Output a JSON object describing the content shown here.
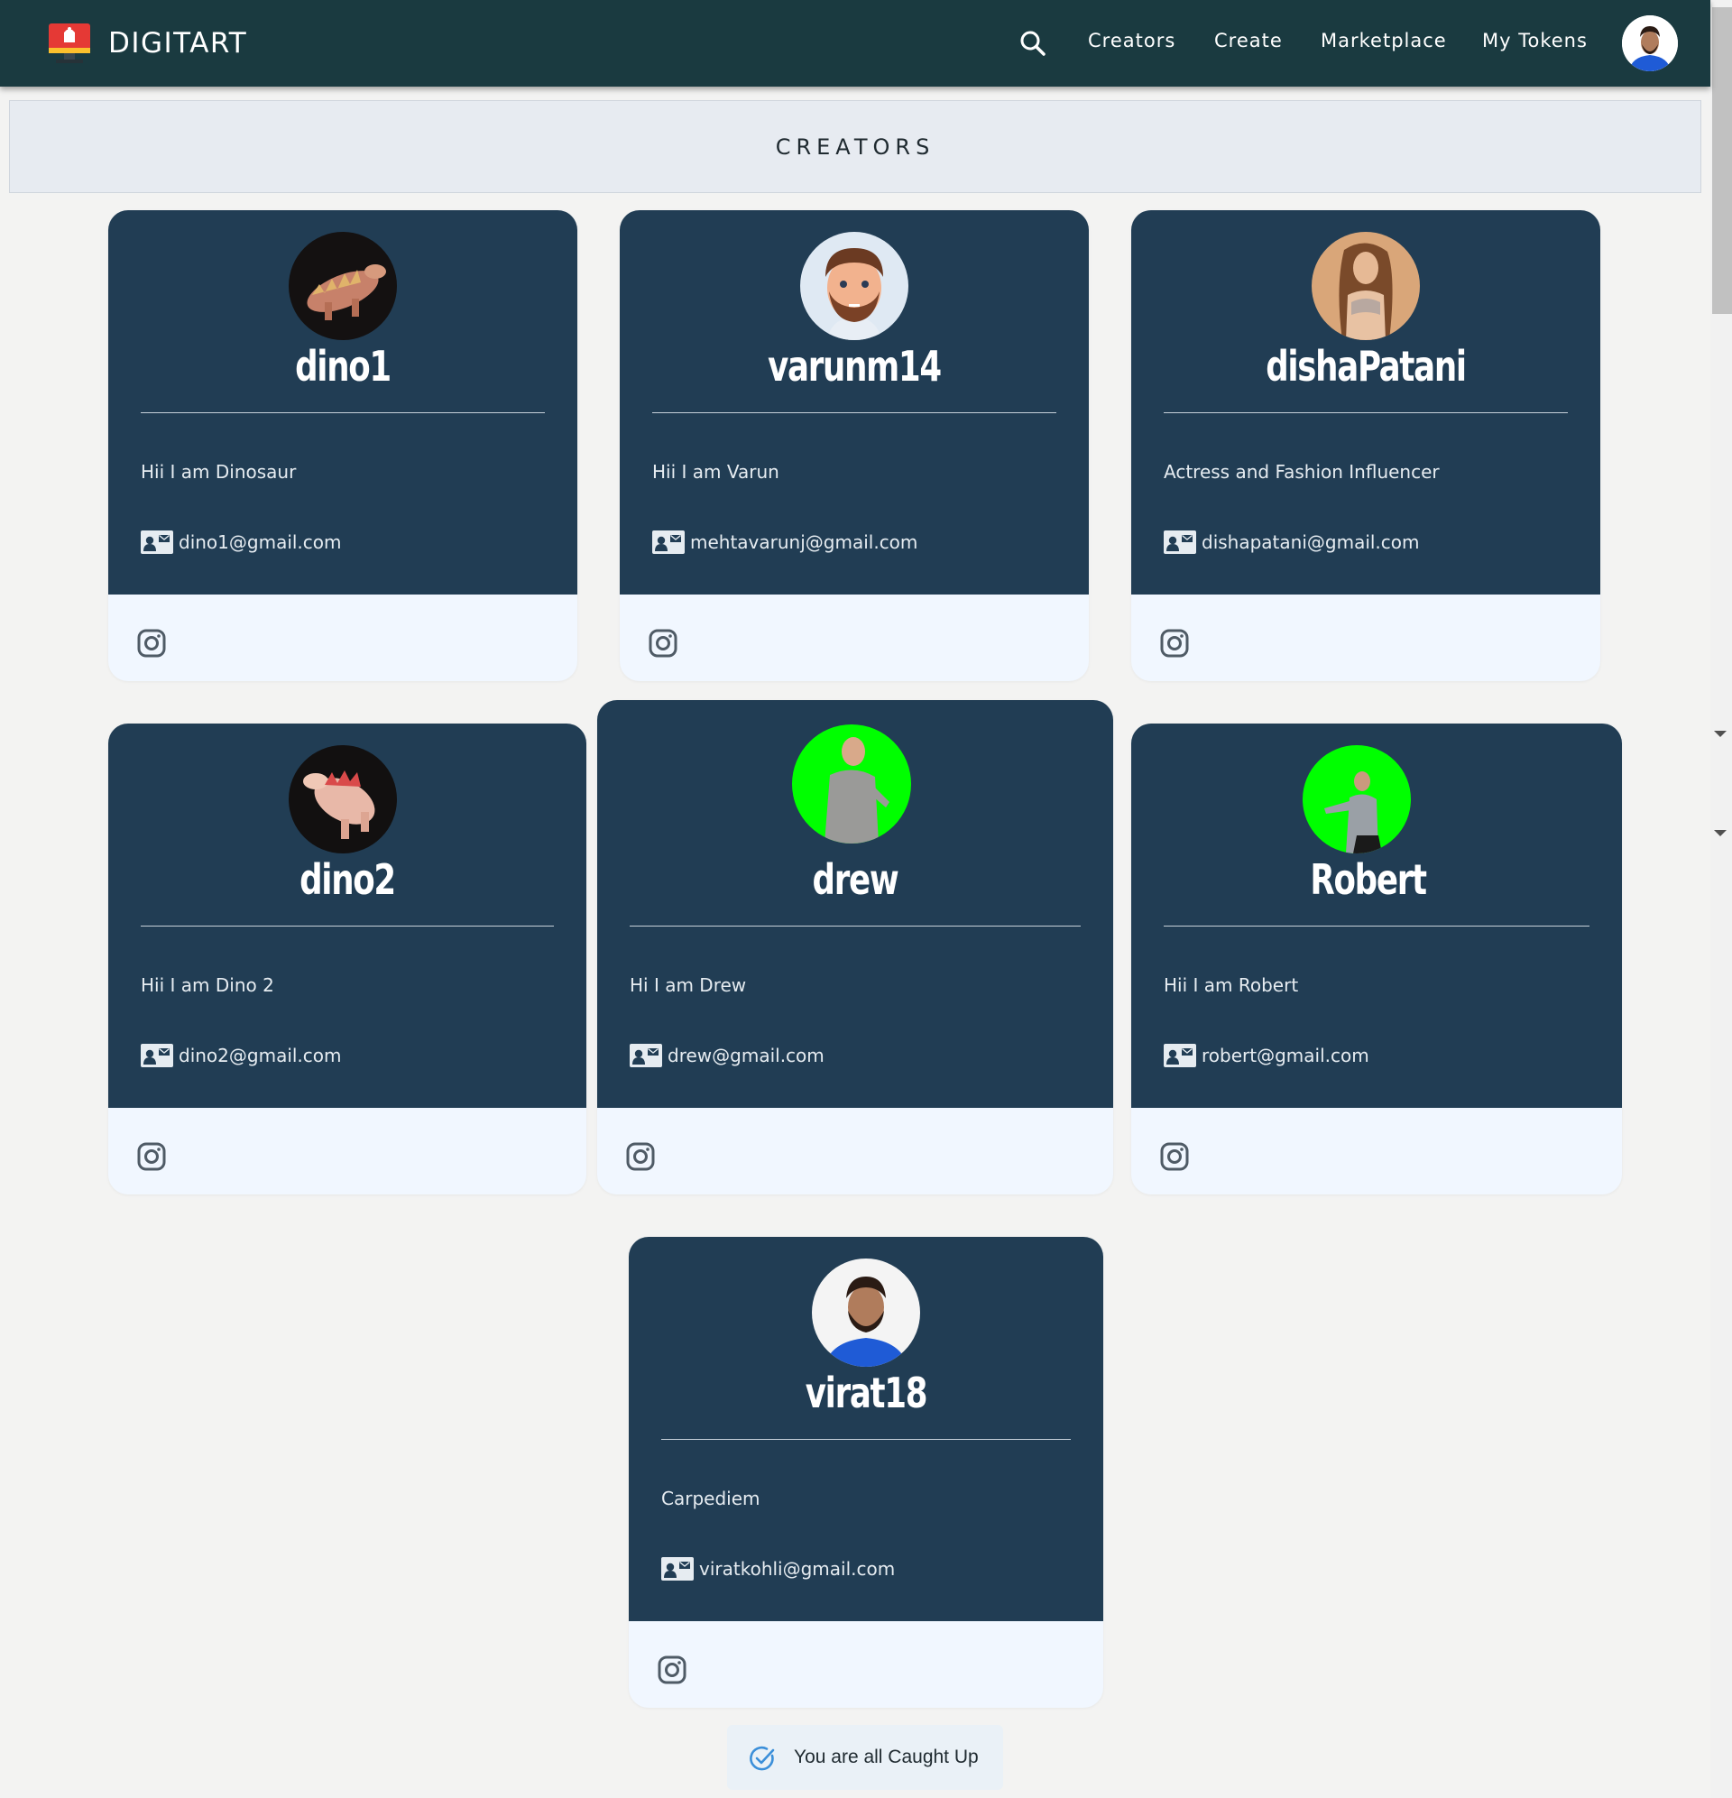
{
  "navbar": {
    "brand": "DIGITART",
    "links": [
      "Creators",
      "Create",
      "Marketplace",
      "My Tokens"
    ]
  },
  "banner": {
    "title": "CREATORS"
  },
  "creators": [
    {
      "username": "dino1",
      "bio": "Hii I am Dinosaur",
      "email": "dino1@gmail.com"
    },
    {
      "username": "varunm14",
      "bio": "Hii I am Varun",
      "email": "mehtavarunj@gmail.com"
    },
    {
      "username": "dishaPatani",
      "bio": "Actress and Fashion Influencer",
      "email": "dishapatani@gmail.com"
    },
    {
      "username": "dino2",
      "bio": "Hii I am Dino 2",
      "email": "dino2@gmail.com"
    },
    {
      "username": "drew",
      "bio": "Hi I am Drew",
      "email": "drew@gmail.com"
    },
    {
      "username": "Robert",
      "bio": "Hii I am Robert",
      "email": "robert@gmail.com"
    },
    {
      "username": "virat18",
      "bio": "Carpediem",
      "email": "viratkohli@gmail.com"
    }
  ],
  "footer": {
    "status": "You are all Caught Up"
  },
  "colors": {
    "navbar": "#1a3a40",
    "card": "#213d54",
    "card_footer": "#f1f7ff",
    "page": "#f3f3f2"
  }
}
